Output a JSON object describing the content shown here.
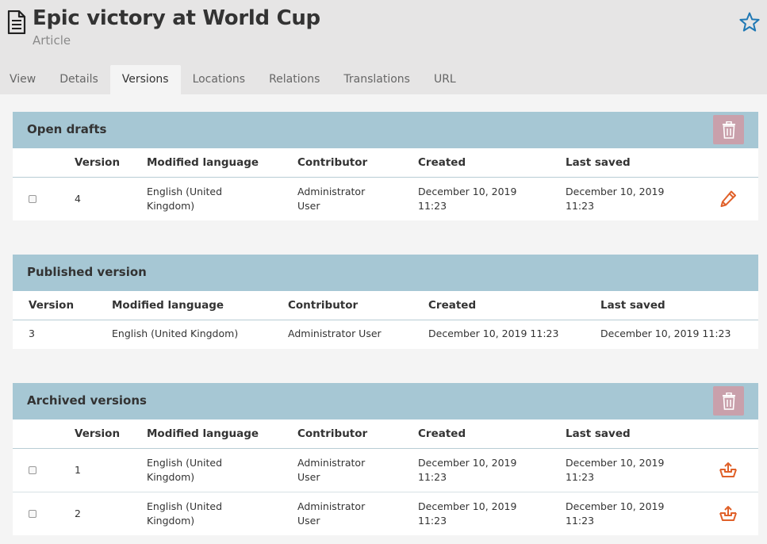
{
  "header": {
    "title": "Epic victory at World Cup",
    "subtitle": "Article",
    "icons": {
      "doc": "document-icon",
      "star": "star-icon"
    }
  },
  "tabs": [
    {
      "label": "View"
    },
    {
      "label": "Details"
    },
    {
      "label": "Versions",
      "active": true
    },
    {
      "label": "Locations"
    },
    {
      "label": "Relations"
    },
    {
      "label": "Translations"
    },
    {
      "label": "URL"
    }
  ],
  "columns": {
    "version": "Version",
    "language": "Modified language",
    "contributor": "Contributor",
    "created": "Created",
    "last_saved": "Last saved"
  },
  "drafts": {
    "title": "Open drafts",
    "rows": [
      {
        "version": "4",
        "language": "English (United Kingdom)",
        "contributor": "Administrator User",
        "created": "December 10, 2019 11:23",
        "last_saved": "December 10, 2019 11:23",
        "action": "pencil-icon"
      }
    ]
  },
  "published": {
    "title": "Published version",
    "rows": [
      {
        "version": "3",
        "language": "English (United Kingdom)",
        "contributor": "Administrator User",
        "created": "December 10, 2019 11:23",
        "last_saved": "December 10, 2019 11:23"
      }
    ]
  },
  "archived": {
    "title": "Archived versions",
    "rows": [
      {
        "version": "1",
        "language": "English (United Kingdom)",
        "contributor": "Administrator User",
        "created": "December 10, 2019 11:23",
        "last_saved": "December 10, 2019 11:23",
        "action": "restore-icon"
      },
      {
        "version": "2",
        "language": "English (United Kingdom)",
        "contributor": "Administrator User",
        "created": "December 10, 2019 11:23",
        "last_saved": "December 10, 2019 11:23",
        "action": "restore-icon"
      }
    ]
  },
  "colors": {
    "header_bg": "#e6e5e5",
    "panel_head": "#a6c7d4",
    "trash_btn": "#c9a0ab",
    "action_orange": "#e0612a",
    "star_blue": "#1f78b4"
  }
}
